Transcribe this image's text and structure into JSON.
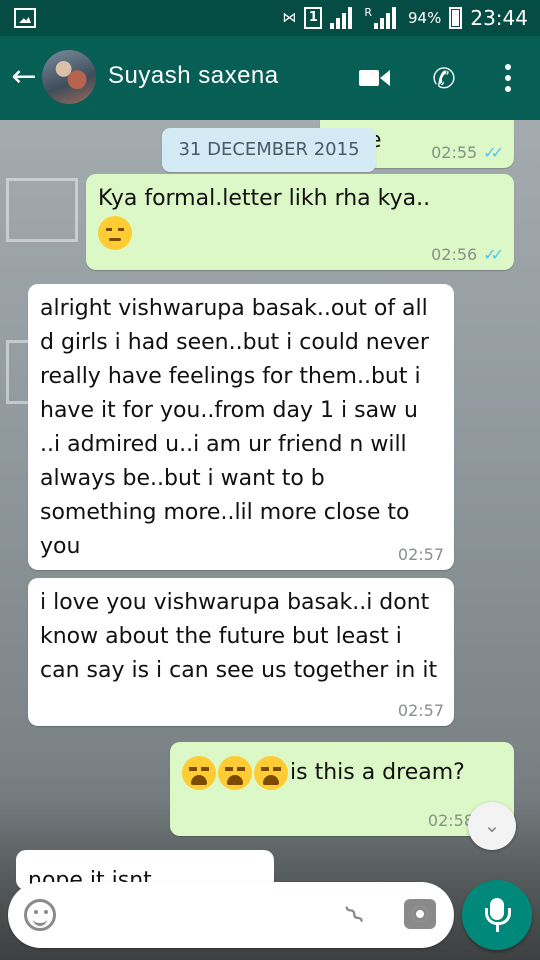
{
  "status_bar": {
    "battery_percent": "94%",
    "time": "23:44",
    "sim_label": "1",
    "network_label": "R"
  },
  "header": {
    "contact_name": "Suyash saxena"
  },
  "chat": {
    "date_chip": "31 DECEMBER 2015",
    "messages": [
      {
        "direction": "outgoing",
        "text": "e",
        "time": "02:55",
        "read": true
      },
      {
        "direction": "outgoing",
        "text": "Kya formal.letter likh rha kya..",
        "emoji": "unamused-face",
        "time": "02:56",
        "read": true
      },
      {
        "direction": "incoming",
        "text": "alright vishwarupa basak..out of all d girls i had seen..but i could never really have feelings for them..but i have it for you..from day 1 i saw u ..i admired u..i am ur friend n will always be..but i want to b something more..lil more close to you",
        "time": "02:57"
      },
      {
        "direction": "incoming",
        "text": "i love you vishwarupa basak..i dont know about the future but least i can say is i can see us together in it",
        "time": "02:57"
      },
      {
        "direction": "outgoing",
        "text": "is this a dream?",
        "emoji": "loudly-crying-face x3",
        "time": "02:58"
      },
      {
        "direction": "incoming",
        "text": "nope it isnt"
      }
    ]
  },
  "composer": {
    "placeholder": ""
  },
  "colors": {
    "app_bar": "#075e54",
    "status_bar": "#054d44",
    "outgoing_bubble": "#dcf8c6",
    "incoming_bubble": "#ffffff",
    "mic_button": "#00897b",
    "read_ticks": "#4fc3f7"
  }
}
